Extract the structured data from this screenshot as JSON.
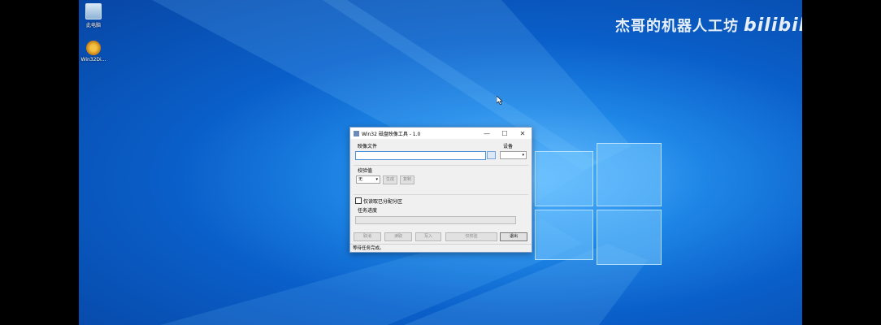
{
  "desktop": {
    "icons": [
      {
        "label": "此电脑"
      },
      {
        "label": "Win32Di..."
      }
    ],
    "watermark": {
      "text": "杰哥的机器人工坊",
      "brand": "bilibili"
    }
  },
  "window": {
    "title": "Win32 磁盘映像工具 - 1.0",
    "controls": {
      "minimize": "—",
      "maximize": "☐",
      "close": "✕"
    },
    "image_file_label": "映像文件",
    "image_file_value": "",
    "device_label": "设备",
    "device_value": "",
    "checksum_label": "校验值",
    "checksum_type": "无",
    "generate_label": "生成",
    "copy_label": "复制",
    "read_allocated_label": "仅读取已分配分区",
    "progress_label": "任务进度",
    "progress_value": 0,
    "buttons": {
      "cancel": "取消",
      "read": "读取",
      "write": "写入",
      "verify": "仅校验",
      "exit": "退出"
    },
    "status": "等待任务完成。"
  },
  "colors": {
    "accent": "#0a5fc9",
    "window_border": "#7a9cc6"
  }
}
